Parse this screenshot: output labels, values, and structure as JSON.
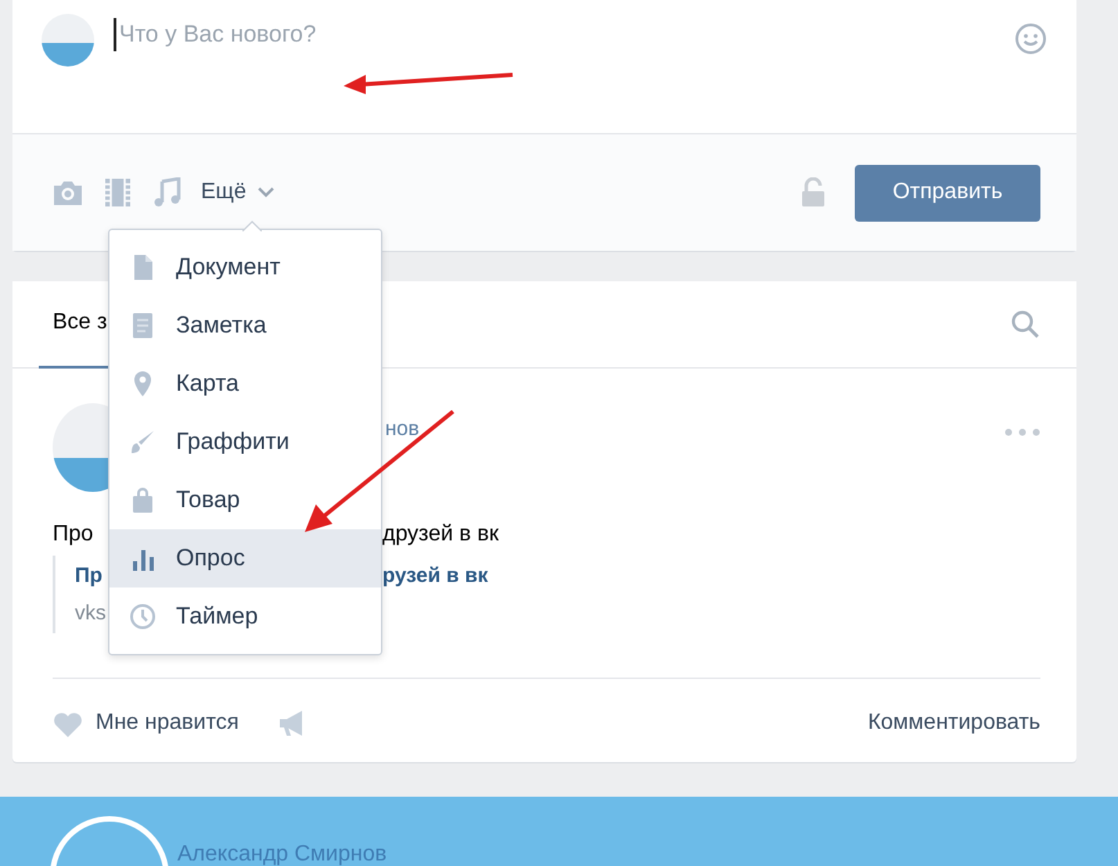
{
  "composer": {
    "placeholder": "Что у Вас нового?",
    "more": "Ещё",
    "submit": "Отправить",
    "menu": [
      {
        "label": "Документ",
        "kind": "document",
        "selected": false
      },
      {
        "label": "Заметка",
        "kind": "note",
        "selected": false
      },
      {
        "label": "Карта",
        "kind": "map",
        "selected": false
      },
      {
        "label": "Граффити",
        "kind": "graffiti",
        "selected": false
      },
      {
        "label": "Товар",
        "kind": "product",
        "selected": false
      },
      {
        "label": "Опрос",
        "kind": "poll",
        "selected": true
      },
      {
        "label": "Таймер",
        "kind": "timer",
        "selected": false
      }
    ]
  },
  "feed": {
    "tab": "Все з",
    "post": {
      "author": "нов",
      "text_start": "Про",
      "text_end": "друзей в вк",
      "link_title_start": "Пр",
      "link_title_end": "рузей в вк",
      "link_url": "vks",
      "like": "Мне нравится",
      "comment": "Комментировать"
    }
  },
  "next_post": {
    "author": "Александр Смирнов"
  }
}
